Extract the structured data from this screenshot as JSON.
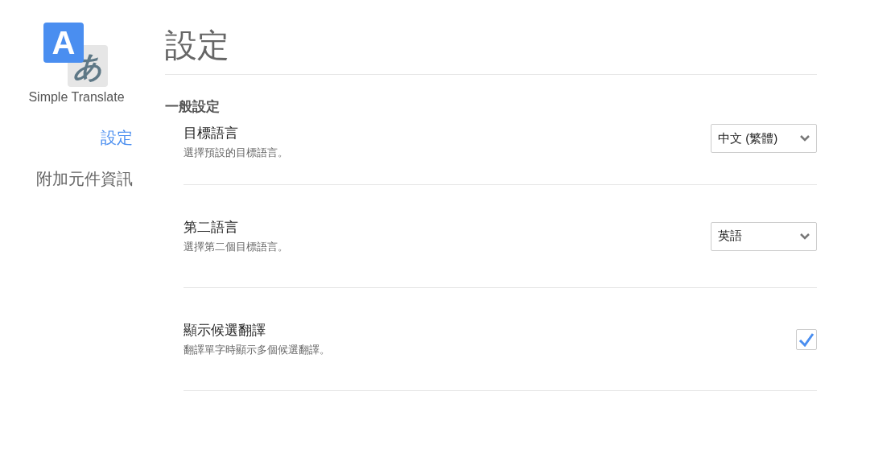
{
  "logo": {
    "letter": "A",
    "kana": "あ",
    "name": "Simple Translate"
  },
  "nav": [
    {
      "label": "設定",
      "selected": true
    },
    {
      "label": "附加元件資訊",
      "selected": false
    }
  ],
  "title": "設定",
  "section": {
    "heading": "一般設定",
    "settings": [
      {
        "kind": "select",
        "label": "目標語言",
        "description": "選擇預設的目標語言。",
        "value": "中文 (繁體)"
      },
      {
        "kind": "select",
        "label": "第二語言",
        "description": "選擇第二個目標語言。",
        "value": "英語"
      },
      {
        "kind": "checkbox",
        "label": "顯示候選翻譯",
        "description": "翻譯單字時顯示多個候選翻譯。",
        "checked": true
      }
    ]
  }
}
